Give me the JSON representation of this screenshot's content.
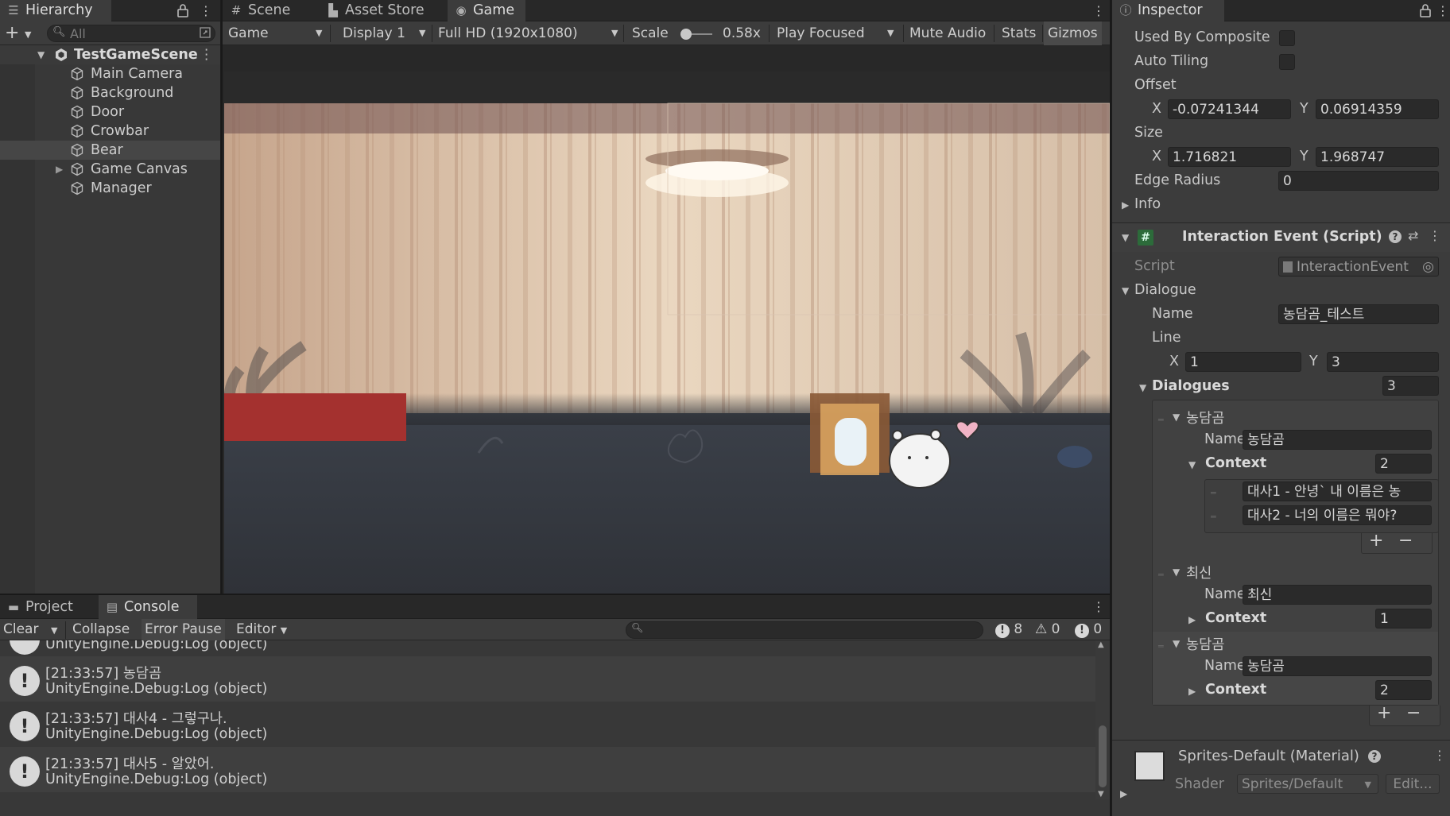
{
  "hierarchy": {
    "tab_label": "Hierarchy",
    "search_placeholder": "All",
    "scene_name": "TestGameScene",
    "items": [
      {
        "label": "Main Camera"
      },
      {
        "label": "Background"
      },
      {
        "label": "Door"
      },
      {
        "label": "Crowbar"
      },
      {
        "label": "Bear"
      },
      {
        "label": "Game Canvas"
      },
      {
        "label": "Manager"
      }
    ]
  },
  "game": {
    "tabs": {
      "scene": "Scene",
      "asset_store": "Asset Store",
      "game": "Game"
    },
    "toolbar": {
      "mode": "Game",
      "display": "Display 1",
      "resolution": "Full HD (1920x1080)",
      "scale_label": "Scale",
      "scale_value": "0.58x",
      "play_mode": "Play Focused",
      "mute": "Mute Audio",
      "stats": "Stats",
      "gizmos": "Gizmos"
    }
  },
  "console": {
    "tabs": {
      "project": "Project",
      "console": "Console"
    },
    "toolbar": {
      "clear": "Clear",
      "collapse": "Collapse",
      "error_pause": "Error Pause",
      "editor": "Editor"
    },
    "counts": {
      "info": "8",
      "warn": "0",
      "error": "0"
    },
    "partial_line": "UnityEngine.Debug:Log (object)",
    "entries": [
      {
        "message": "[21:33:57] 농담곰",
        "trace": "UnityEngine.Debug:Log (object)"
      },
      {
        "message": "[21:33:57] 대사4 - 그렇구나.",
        "trace": "UnityEngine.Debug:Log (object)"
      },
      {
        "message": "[21:33:57] 대사5 - 알았어.",
        "trace": "UnityEngine.Debug:Log (object)"
      }
    ]
  },
  "inspector": {
    "tab_label": "Inspector",
    "used_by_composite": "Used By Composite",
    "auto_tiling": "Auto Tiling",
    "offset": {
      "label": "Offset",
      "x_label": "X",
      "x": "-0.07241344",
      "y_label": "Y",
      "y": "0.06914359"
    },
    "size": {
      "label": "Size",
      "x_label": "X",
      "x": "1.716821",
      "y_label": "Y",
      "y": "1.968747"
    },
    "edge_radius": {
      "label": "Edge Radius",
      "value": "0"
    },
    "info": "Info",
    "component": {
      "title": "Interaction Event (Script)",
      "script_label": "Script",
      "script_value": "InteractionEvent",
      "dialogue_label": "Dialogue",
      "name_label": "Name",
      "name_value": "농담곰_테스트",
      "line_label": "Line",
      "line_x_label": "X",
      "line_x": "1",
      "line_y_label": "Y",
      "line_y": "3",
      "dialogues_label": "Dialogues",
      "dialogues_count": "3",
      "elements": [
        {
          "header": "농담곰",
          "name_label": "Name",
          "name": "농담곰",
          "context_label": "Context",
          "context_count": "2",
          "context_items": [
            "대사1 - 안녕` 내 이름은 농",
            "대사2 - 너의 이름은 뭐야?"
          ]
        },
        {
          "header": "최신",
          "name_label": "Name",
          "name": "최신",
          "context_label": "Context",
          "context_count": "1"
        },
        {
          "header": "농담곰",
          "name_label": "Name",
          "name": "농담곰",
          "context_label": "Context",
          "context_count": "2"
        }
      ]
    },
    "material": {
      "title": "Sprites-Default (Material)",
      "shader_label": "Shader",
      "shader_value": "Sprites/Default",
      "edit_label": "Edit..."
    }
  }
}
